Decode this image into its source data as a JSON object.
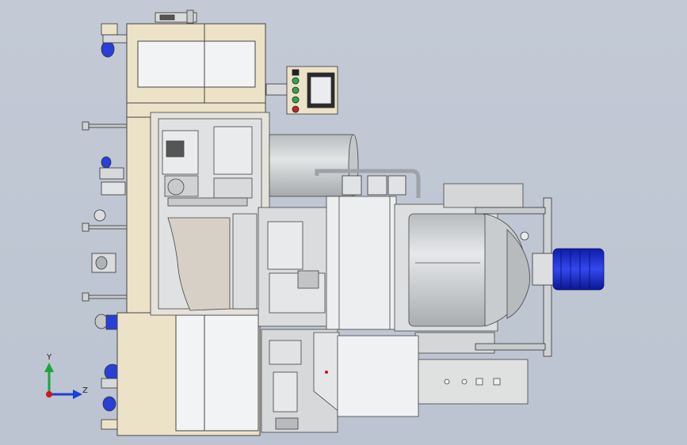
{
  "viewport": {
    "background_top": "#c3cad6",
    "background_bottom": "#bcc4d1"
  },
  "model": {
    "frame_color": "#ece2c8",
    "panel_color": "#e8ebed",
    "steel_color": "#d3d6d8",
    "drum_color": "#cfd2d4",
    "motor_color": "#1d2fd0",
    "lamp_colors": [
      "#222222",
      "#2fa84a",
      "#2fa84a",
      "#2fa84a",
      "#c02828"
    ]
  },
  "triad": {
    "y_label": "Y",
    "z_label": "Z",
    "y_color": "#18a83a",
    "z_color": "#1c3fd8",
    "origin_color": "#d01818"
  }
}
